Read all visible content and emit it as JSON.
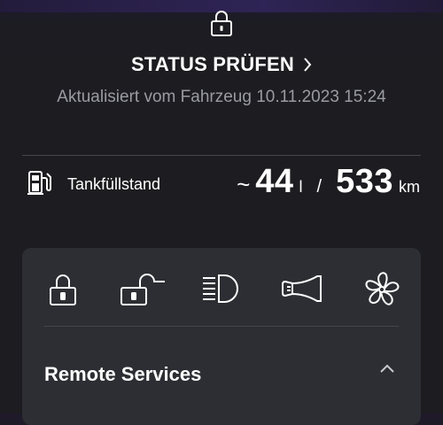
{
  "status": {
    "icon": "lock-icon",
    "title": "STATUS PRÜFEN",
    "updated": "Aktualisiert vom Fahrzeug 10.11.2023 15:24"
  },
  "fuel": {
    "icon": "fuel-pump-icon",
    "label": "Tankfüllstand",
    "approx": "~",
    "liters": "44",
    "liters_unit": "l",
    "separator": "/",
    "range": "533",
    "range_unit": "km"
  },
  "remote_services": {
    "actions": [
      {
        "icon": "lock-icon"
      },
      {
        "icon": "unlock-icon"
      },
      {
        "icon": "headlight-icon"
      },
      {
        "icon": "horn-icon"
      },
      {
        "icon": "fan-icon"
      }
    ],
    "title": "Remote Services",
    "chevron": "chevron-up-icon"
  },
  "colors": {
    "background": "#1d1d21",
    "card": "#2d2e33",
    "text": "#ffffff",
    "muted_text": "#9a9ba1",
    "divider": "#45464c",
    "top_glow": "#2e2354"
  }
}
